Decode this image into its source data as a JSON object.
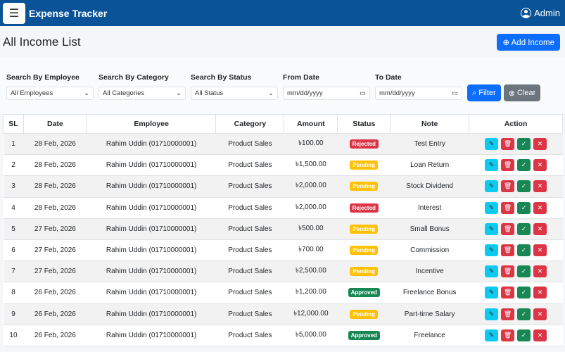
{
  "nav": {
    "brand": "Expense Tracker",
    "user": "Admin"
  },
  "page": {
    "title": "All Income List",
    "add_label": "Add Income"
  },
  "filters": {
    "employee": {
      "label": "Search By Employee",
      "value": "All Employees"
    },
    "category": {
      "label": "Search By Category",
      "value": "All Categories"
    },
    "status": {
      "label": "Search By Status",
      "value": "All Status"
    },
    "from": {
      "label": "From Date",
      "placeholder": "mm/dd/yyyy"
    },
    "to": {
      "label": "To Date",
      "placeholder": "mm/dd/yyyy"
    },
    "filter_label": "Filter",
    "clear_label": "Clear"
  },
  "table": {
    "headers": [
      "SL",
      "Date",
      "Employee",
      "Category",
      "Amount",
      "Status",
      "Note",
      "Action"
    ],
    "rows": [
      {
        "sl": "1",
        "date": "28 Feb, 2026",
        "employee": "Rahim Uddin (01710000001)",
        "category": "Product Sales",
        "amount": "৳100.00",
        "status": "Rejected",
        "note": "Test Entry"
      },
      {
        "sl": "2",
        "date": "28 Feb, 2026",
        "employee": "Rahim Uddin (01710000001)",
        "category": "Product Sales",
        "amount": "৳1,500.00",
        "status": "Pending",
        "note": "Loan Return"
      },
      {
        "sl": "3",
        "date": "28 Feb, 2026",
        "employee": "Rahim Uddin (01710000001)",
        "category": "Product Sales",
        "amount": "৳2,000.00",
        "status": "Pending",
        "note": "Stock Dividend"
      },
      {
        "sl": "4",
        "date": "28 Feb, 2026",
        "employee": "Rahim Uddin (01710000001)",
        "category": "Product Sales",
        "amount": "৳2,000.00",
        "status": "Rejected",
        "note": "Interest"
      },
      {
        "sl": "5",
        "date": "27 Feb, 2026",
        "employee": "Rahim Uddin (01710000001)",
        "category": "Product Sales",
        "amount": "৳500.00",
        "status": "Pending",
        "note": "Small Bonus"
      },
      {
        "sl": "6",
        "date": "27 Feb, 2026",
        "employee": "Rahim Uddin (01710000001)",
        "category": "Product Sales",
        "amount": "৳700.00",
        "status": "Pending",
        "note": "Commission"
      },
      {
        "sl": "7",
        "date": "27 Feb, 2026",
        "employee": "Rahim Uddin (01710000001)",
        "category": "Product Sales",
        "amount": "৳2,500.00",
        "status": "Pending",
        "note": "Incentive"
      },
      {
        "sl": "8",
        "date": "26 Feb, 2026",
        "employee": "Rahim Uddin (01710000001)",
        "category": "Product Sales",
        "amount": "৳1,200.00",
        "status": "Approved",
        "note": "Freelance Bonus"
      },
      {
        "sl": "9",
        "date": "26 Feb, 2026",
        "employee": "Rahim Uddin (01710000001)",
        "category": "Product Sales",
        "amount": "৳12,000.00",
        "status": "Pending",
        "note": "Part-time Salary"
      },
      {
        "sl": "10",
        "date": "26 Feb, 2026",
        "employee": "Rahim Uddin (01710000001)",
        "category": "Product Sales",
        "amount": "৳5,000.00",
        "status": "Approved",
        "note": "Freelance"
      }
    ]
  },
  "colors": {
    "navbar": "#0b5398",
    "primary": "#0d6efd",
    "Rejected": "#dc3545",
    "Pending": "#ffc107",
    "Approved": "#198754",
    "edit": "#0dcaf0",
    "secondary": "#6c757d"
  }
}
